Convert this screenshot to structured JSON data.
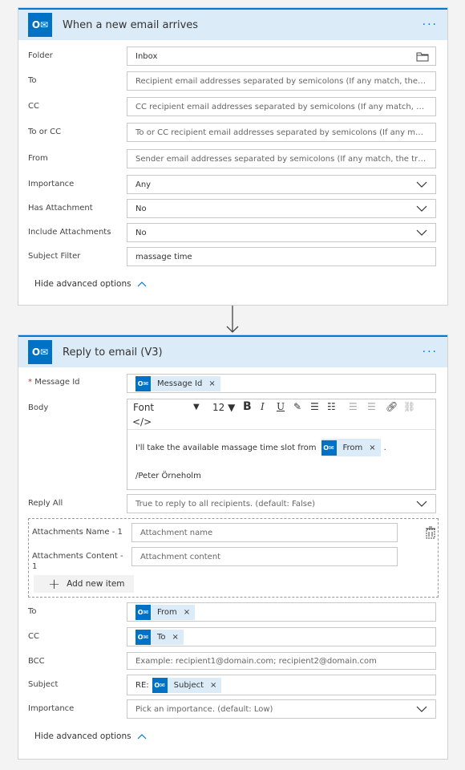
{
  "trigger": {
    "title": "When a new email arrives",
    "icon": "outlook-icon",
    "menu_label": "···",
    "fields": {
      "folder": {
        "label": "Folder",
        "value": "Inbox"
      },
      "to": {
        "label": "To",
        "placeholder": "Recipient email addresses separated by semicolons (If any match, the trigger ..."
      },
      "cc": {
        "label": "CC",
        "placeholder": "CC recipient email addresses separated by semicolons (If any match, the trigg..."
      },
      "to_or_cc": {
        "label": "To or CC",
        "placeholder": "To or CC recipient email addresses separated by semicolons (If any match, th..."
      },
      "from": {
        "label": "From",
        "placeholder": "Sender email addresses separated by semicolons (If any match, the trigger wi..."
      },
      "importance": {
        "label": "Importance",
        "value": "Any"
      },
      "has_attachment": {
        "label": "Has Attachment",
        "value": "No"
      },
      "include_attachments": {
        "label": "Include Attachments",
        "value": "No"
      },
      "subject_filter": {
        "label": "Subject Filter",
        "value": "massage time"
      }
    },
    "hide_advanced": "Hide advanced options"
  },
  "action": {
    "title": "Reply to email (V3)",
    "icon": "outlook-icon",
    "menu_label": "···",
    "message_id": {
      "required_mark": "*",
      "label": "Message Id",
      "token": "Message Id"
    },
    "body": {
      "label": "Body",
      "toolbar": {
        "font": "Font",
        "size": "12",
        "code": "</>"
      },
      "text_before": "I'll take the available massage time slot from",
      "token": "From",
      "text_after": ".",
      "signature": "/Peter Örneholm"
    },
    "reply_all": {
      "label": "Reply All",
      "placeholder": "True to reply to all recipients. (default: False)"
    },
    "attachments": {
      "name_label": "Attachments Name - 1",
      "name_placeholder": "Attachment name",
      "content_label_1": "Attachments Content -",
      "content_label_2": "1",
      "content_placeholder": "Attachment content",
      "add_new": "Add new item"
    },
    "to": {
      "label": "To",
      "token": "From"
    },
    "cc": {
      "label": "CC",
      "token": "To"
    },
    "bcc": {
      "label": "BCC",
      "placeholder": "Example: recipient1@domain.com; recipient2@domain.com"
    },
    "subject": {
      "label": "Subject",
      "prefix": "RE:",
      "token": "Subject"
    },
    "importance": {
      "label": "Importance",
      "placeholder": "Pick an importance. (default: Low)"
    },
    "hide_advanced": "Hide advanced options"
  },
  "colors": {
    "accent": "#0078d4",
    "header_bg": "#dcebf8",
    "outlook": "#0072c6"
  }
}
